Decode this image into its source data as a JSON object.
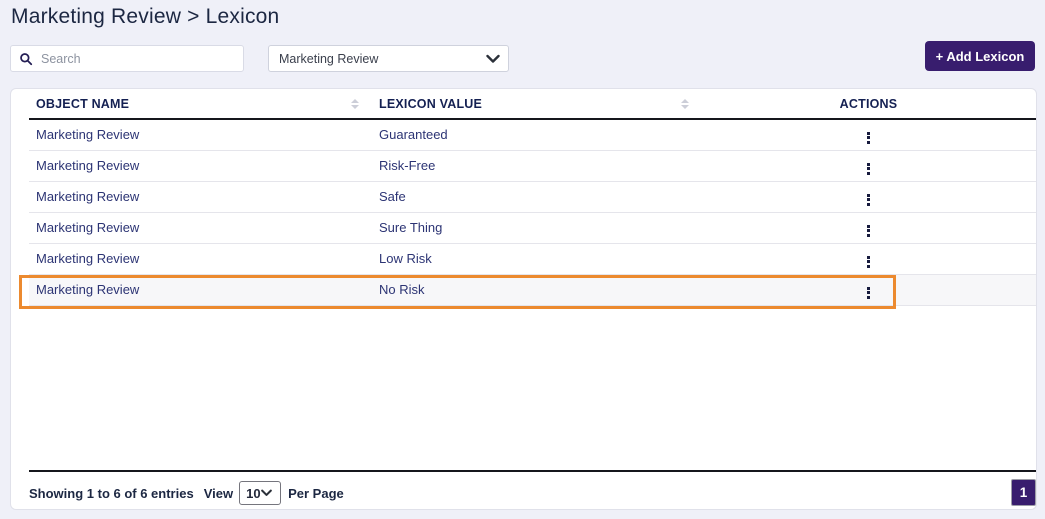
{
  "page_title": "Marketing Review > Lexicon",
  "toolbar": {
    "search_placeholder": "Search",
    "filter_selected": "Marketing Review",
    "add_button": "+ Add Lexicon"
  },
  "table": {
    "headers": [
      "OBJECT NAME",
      "LEXICON VALUE",
      "ACTIONS"
    ],
    "rows": [
      {
        "object": "Marketing Review",
        "value": "Guaranteed"
      },
      {
        "object": "Marketing Review",
        "value": "Risk-Free"
      },
      {
        "object": "Marketing Review",
        "value": "Safe"
      },
      {
        "object": "Marketing Review",
        "value": "Sure Thing"
      },
      {
        "object": "Marketing Review",
        "value": "Low Risk"
      },
      {
        "object": "Marketing Review",
        "value": "No Risk"
      }
    ],
    "highlighted_row_index": 5
  },
  "footer": {
    "showing": "Showing 1 to 6 of 6 entries",
    "view_label": "View",
    "page_size": "10",
    "per_page_label": "Per Page",
    "current_page": "1"
  },
  "colors": {
    "accent_purple": "#381d6e",
    "highlight_orange": "#ec8a2f",
    "page_background": "#eff0f8",
    "header_text": "#142052",
    "row_text": "#2c3474"
  }
}
